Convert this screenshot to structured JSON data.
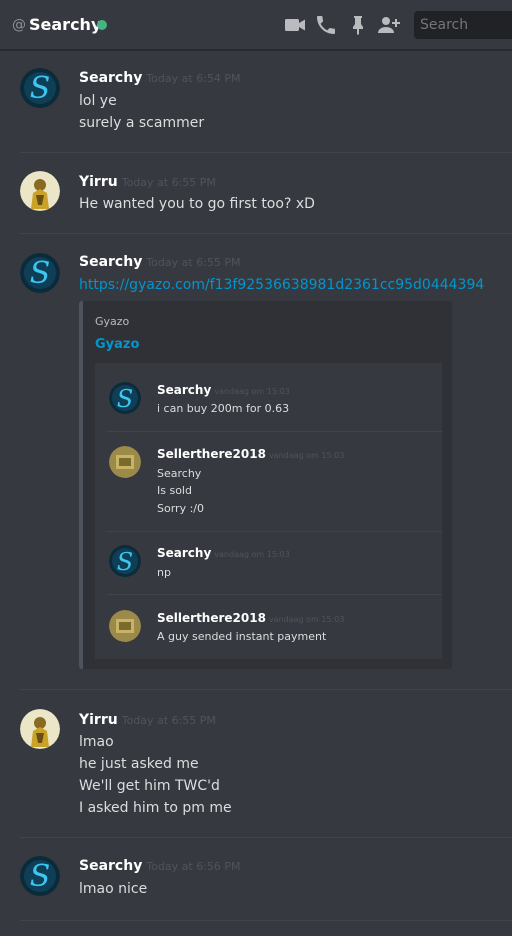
{
  "header": {
    "at_symbol": "@",
    "channel_name": "Searchy",
    "status_color": "#43b581",
    "icons": [
      "video-call-icon",
      "phone-call-icon",
      "pin-icon",
      "add-member-icon"
    ],
    "search_placeholder": "Search"
  },
  "messages": [
    {
      "author": "Searchy",
      "timestamp": "Today at 6:54 PM",
      "lines": [
        "lol ye",
        "surely a scammer"
      ]
    },
    {
      "author": "Yirru",
      "timestamp": "Today at 6:55 PM",
      "lines": [
        "He wanted you to go first too? xD"
      ]
    },
    {
      "author": "Searchy",
      "timestamp": "Today at 6:55 PM",
      "link": "https://gyazo.com/f13f92536638981d2361cc95d0444394",
      "embed": {
        "provider": "Gyazo",
        "title": "Gyazo",
        "screenshot_messages": [
          {
            "author": "Searchy",
            "timestamp": "vandaag om 15:03",
            "lines": [
              "i can buy 200m for 0.63"
            ]
          },
          {
            "author": "Sellerthere2018",
            "timestamp": "vandaag om 15:03",
            "lines": [
              "Searchy",
              "Is sold",
              "Sorry :/0"
            ]
          },
          {
            "author": "Searchy",
            "timestamp": "vandaag om 15:03",
            "lines": [
              "np"
            ]
          },
          {
            "author": "Sellerthere2018",
            "timestamp": "vandaag om 15:03",
            "lines": [
              "A guy sended instant payment"
            ]
          }
        ]
      }
    },
    {
      "author": "Yirru",
      "timestamp": "Today at 6:55 PM",
      "lines": [
        "lmao",
        "he just asked me",
        "We'll get him TWC'd",
        "I asked him to pm me"
      ]
    },
    {
      "author": "Searchy",
      "timestamp": "Today at 6:56 PM",
      "lines": [
        "lmao nice"
      ]
    }
  ],
  "colors": {
    "link": "#0096cf",
    "background": "#36393f",
    "embed_background": "#2f3136"
  }
}
